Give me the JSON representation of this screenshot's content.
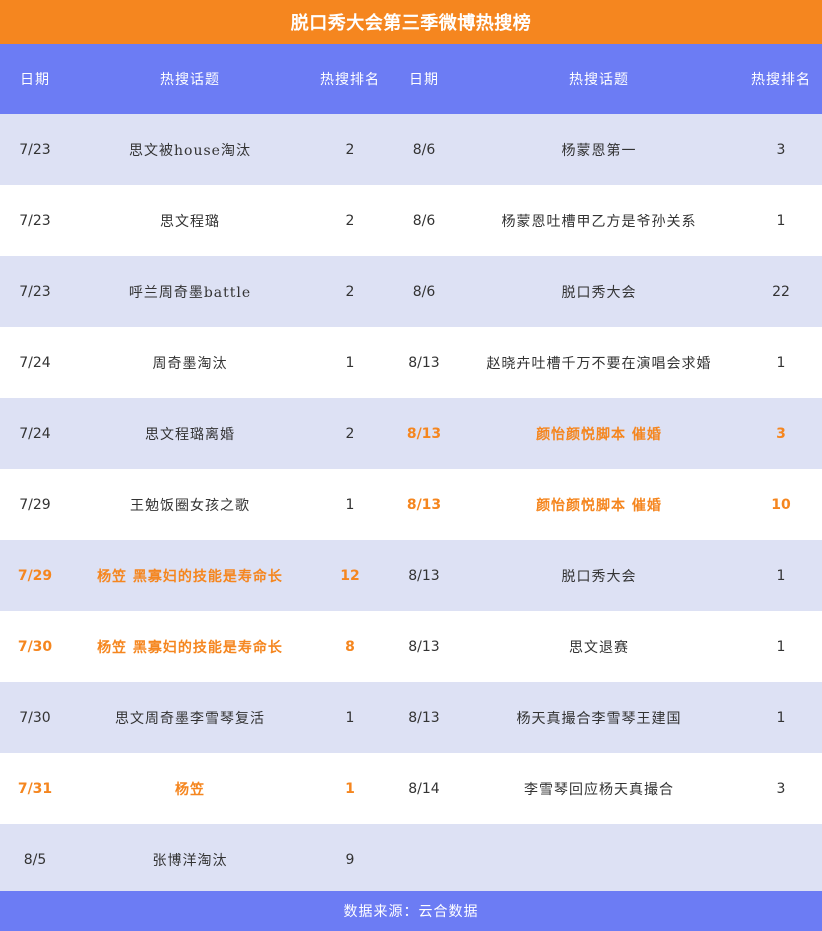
{
  "title": "脱口秀大会第三季微博热搜榜",
  "columns": [
    "日期",
    "热搜话题",
    "热搜排名",
    "日期",
    "热搜话题",
    "热搜排名"
  ],
  "colors": {
    "title_bar": "#f5861f",
    "header": "#6c7cf4",
    "row_alt": "#dde1f4",
    "highlight": "#f5861f"
  },
  "footer": "数据来源：云合数据",
  "chart_data": {
    "type": "table",
    "title": "脱口秀大会第三季微博热搜榜",
    "columns": [
      "日期",
      "热搜话题",
      "热搜排名",
      "日期",
      "热搜话题",
      "热搜排名"
    ],
    "rows": [
      {
        "left": {
          "date": "7/23",
          "topic": "思文被house淘汰",
          "rank": "2",
          "hl": false
        },
        "right": {
          "date": "8/6",
          "topic": "杨蒙恩第一",
          "rank": "3",
          "hl": false
        }
      },
      {
        "left": {
          "date": "7/23",
          "topic": "思文程璐",
          "rank": "2",
          "hl": false
        },
        "right": {
          "date": "8/6",
          "topic": "杨蒙恩吐槽甲乙方是爷孙关系",
          "rank": "1",
          "hl": false
        }
      },
      {
        "left": {
          "date": "7/23",
          "topic": "呼兰周奇墨battle",
          "rank": "2",
          "hl": false
        },
        "right": {
          "date": "8/6",
          "topic": "脱口秀大会",
          "rank": "22",
          "hl": false
        }
      },
      {
        "left": {
          "date": "7/24",
          "topic": "周奇墨淘汰",
          "rank": "1",
          "hl": false
        },
        "right": {
          "date": "8/13",
          "topic": "赵晓卉吐槽千万不要在演唱会求婚",
          "rank": "1",
          "hl": false
        }
      },
      {
        "left": {
          "date": "7/24",
          "topic": "思文程璐离婚",
          "rank": "2",
          "hl": false
        },
        "right": {
          "date": "8/13",
          "topic": "颜怡颜悦脚本 催婚",
          "rank": "3",
          "hl": true
        }
      },
      {
        "left": {
          "date": "7/29",
          "topic": "王勉饭圈女孩之歌",
          "rank": "1",
          "hl": false
        },
        "right": {
          "date": "8/13",
          "topic": "颜怡颜悦脚本 催婚",
          "rank": "10",
          "hl": true
        }
      },
      {
        "left": {
          "date": "7/29",
          "topic": "杨笠 黑寡妇的技能是寿命长",
          "rank": "12",
          "hl": true
        },
        "right": {
          "date": "8/13",
          "topic": "脱口秀大会",
          "rank": "1",
          "hl": false
        }
      },
      {
        "left": {
          "date": "7/30",
          "topic": "杨笠 黑寡妇的技能是寿命长",
          "rank": "8",
          "hl": true
        },
        "right": {
          "date": "8/13",
          "topic": "思文退赛",
          "rank": "1",
          "hl": false
        }
      },
      {
        "left": {
          "date": "7/30",
          "topic": "思文周奇墨李雪琴复活",
          "rank": "1",
          "hl": false
        },
        "right": {
          "date": "8/13",
          "topic": "杨天真撮合李雪琴王建国",
          "rank": "1",
          "hl": false
        }
      },
      {
        "left": {
          "date": "7/31",
          "topic": "杨笠",
          "rank": "1",
          "hl": true
        },
        "right": {
          "date": "8/14",
          "topic": "李雪琴回应杨天真撮合",
          "rank": "3",
          "hl": false
        }
      },
      {
        "left": {
          "date": "8/5",
          "topic": "张博洋淘汰",
          "rank": "9",
          "hl": false
        },
        "right": {
          "date": "",
          "topic": "",
          "rank": "",
          "hl": false
        }
      }
    ]
  }
}
